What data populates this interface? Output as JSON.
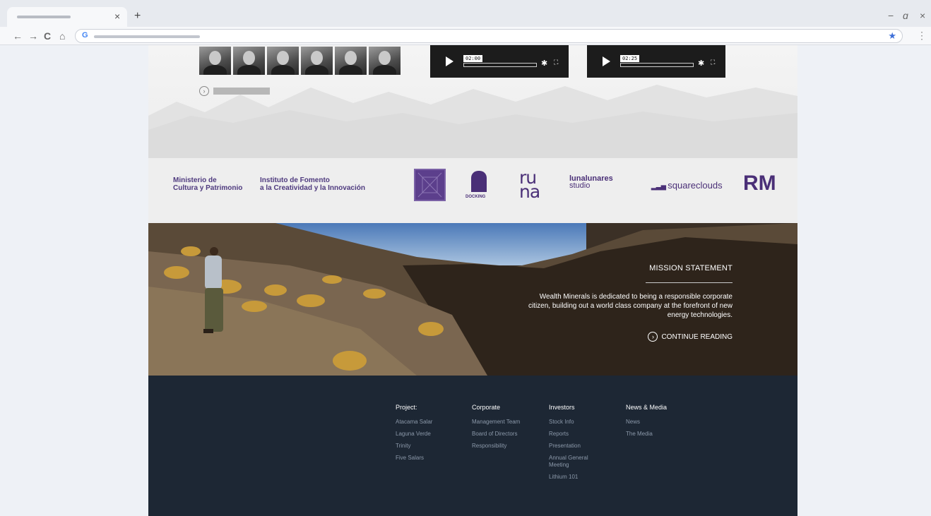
{
  "browser": {
    "tab_close": "×",
    "new_tab": "+",
    "win_min": "−",
    "win_restore": "ɑ",
    "win_close": "×",
    "back": "←",
    "forward": "→",
    "reload": "C",
    "home": "⌂",
    "g_icon": "G",
    "star": "★",
    "menu": "⋮"
  },
  "media": {
    "players": [
      {
        "time": "02:00"
      },
      {
        "time": "02:25"
      }
    ]
  },
  "sponsors": {
    "ministerio_line1": "Ministerio de",
    "ministerio_line2": "Cultura y Patrimonio",
    "instituto_line1": "Instituto de Fomento",
    "instituto_line2": "a la Creatividad y la Innovación",
    "docking": "DOCKING",
    "runa_line1": "ru",
    "runa_line2": "na",
    "lunalunares_line1": "lunalunares",
    "lunalunares_line2": "studio",
    "squareclouds": "squareclouds",
    "rm": "RM"
  },
  "mission": {
    "title": "MISSION STATEMENT",
    "text": "Wealth Minerals is dedicated to being a responsible corporate citizen, building out a world class company at the forefront of new energy technologies.",
    "continue": "CONTINUE READING"
  },
  "footer": {
    "columns": [
      {
        "heading": "Project:",
        "links": [
          "Atacama Salar",
          "Laguna Verde",
          "Trinity",
          "Five Salars"
        ]
      },
      {
        "heading": "Corporate",
        "links": [
          "Management Team",
          "Board of Directors",
          "Responsibility"
        ]
      },
      {
        "heading": "Investors",
        "links": [
          "Stock Info",
          "Reports",
          "Presentation",
          "Annual General Meeting",
          "Lithium 101"
        ]
      },
      {
        "heading": "News & Media",
        "links": [
          "News",
          "The Media"
        ]
      }
    ]
  },
  "colors": {
    "brand_purple": "#4a2f77",
    "footer_bg": "#1d2734"
  }
}
